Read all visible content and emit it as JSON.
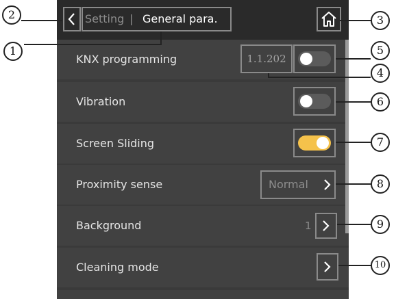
{
  "header": {
    "back_glyph": "<",
    "title_parent": "Setting",
    "separator": "|",
    "title_current": "General para.",
    "home_icon": "home-icon"
  },
  "rows": [
    {
      "label": "KNX programming",
      "address": "1.1.202",
      "control": "toggle",
      "on": false
    },
    {
      "label": "Vibration",
      "control": "toggle",
      "on": false
    },
    {
      "label": "Screen Sliding",
      "control": "toggle",
      "on": true
    },
    {
      "label": "Proximity sense",
      "value": "Normal",
      "control": "chevron"
    },
    {
      "label": "Background",
      "value": "1",
      "control": "chevron"
    },
    {
      "label": "Cleaning mode",
      "control": "chevron"
    }
  ],
  "callouts": [
    "1",
    "2",
    "3",
    "4",
    "5",
    "6",
    "7",
    "8",
    "9",
    "10"
  ],
  "colors": {
    "accent_toggle_on": "#f5c24b",
    "toggle_off": "#5b5b5b",
    "panel_bg": "#3a3a3a",
    "row_bg": "#414141",
    "header_bg": "#2a2a2a",
    "frame": "#8a8a8a"
  }
}
